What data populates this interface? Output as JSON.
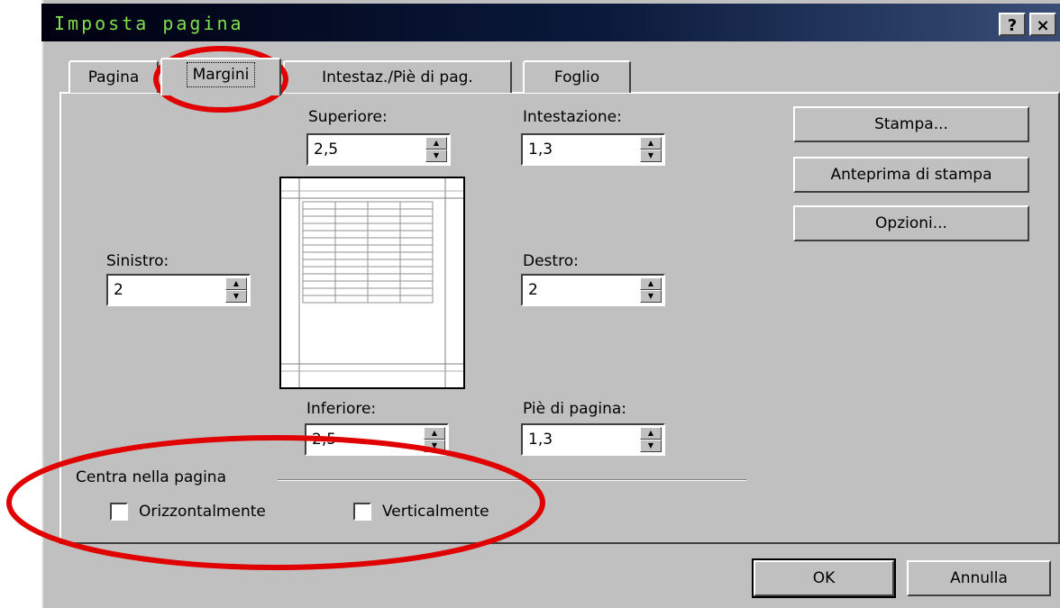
{
  "window": {
    "title": "Imposta pagina",
    "help_label": "?",
    "close_label": "×"
  },
  "tabs": [
    {
      "label": "Pagina"
    },
    {
      "label": "Margini"
    },
    {
      "label": "Intestaz./Piè di pag."
    },
    {
      "label": "Foglio"
    }
  ],
  "active_tab": "Margini",
  "margins": {
    "superiore": {
      "label": "Superiore:",
      "value": "2,5"
    },
    "intestazione": {
      "label": "Intestazione:",
      "value": "1,3"
    },
    "sinistro": {
      "label": "Sinistro:",
      "value": "2"
    },
    "destro": {
      "label": "Destro:",
      "value": "2"
    },
    "inferiore": {
      "label": "Inferiore:",
      "value": "2,5"
    },
    "pie_di_pagina": {
      "label": "Piè di pagina:",
      "value": "1,3"
    }
  },
  "side_buttons": {
    "stampa": "Stampa...",
    "anteprima": "Anteprima di stampa",
    "opzioni": "Opzioni..."
  },
  "center": {
    "group_label": "Centra nella pagina",
    "horizontal": {
      "label": "Orizzontalmente",
      "checked": false
    },
    "vertical": {
      "label": "Verticalmente",
      "checked": false
    }
  },
  "footer": {
    "ok": "OK",
    "cancel": "Annulla"
  },
  "annotation_color": "#e00000"
}
